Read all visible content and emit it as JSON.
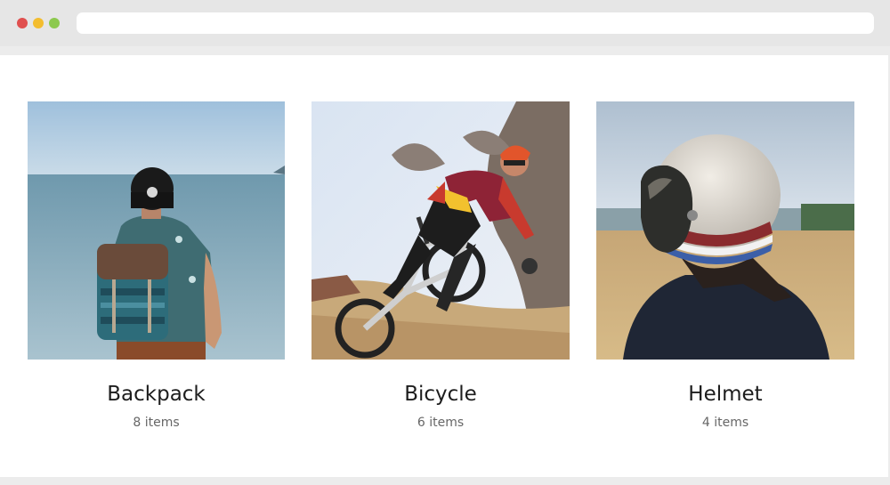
{
  "browser": {
    "address_value": "",
    "controls": [
      "close-dot",
      "minimize-dot",
      "maximize-dot"
    ]
  },
  "colors": {
    "close": "#e0504f",
    "minimize": "#f3bd2f",
    "maximize": "#8cc94e",
    "title_text": "#1d1d1d",
    "count_text": "#666666"
  },
  "categories": [
    {
      "title": "Backpack",
      "count": "8 items",
      "image": "person-with-backpack-at-sea"
    },
    {
      "title": "Bicycle",
      "count": "6 items",
      "image": "mountain-biker-jumping"
    },
    {
      "title": "Helmet",
      "count": "4 items",
      "image": "person-wearing-helmet-in-field"
    }
  ]
}
